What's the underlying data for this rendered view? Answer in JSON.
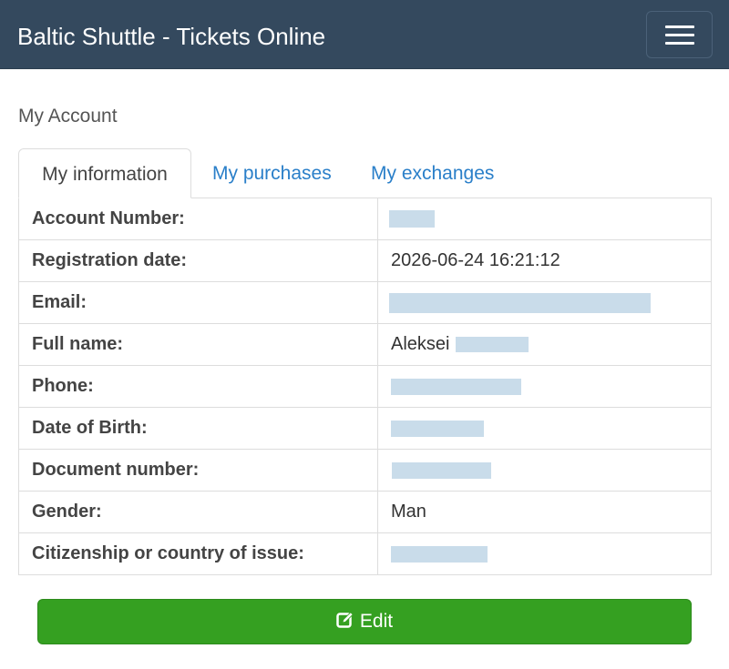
{
  "header": {
    "brand": "Baltic Shuttle - Tickets Online",
    "menu_icon": "hamburger-icon"
  },
  "page": {
    "title": "My Account"
  },
  "tabs": [
    {
      "label": "My information",
      "active": true
    },
    {
      "label": "My purchases",
      "active": false
    },
    {
      "label": "My exchanges",
      "active": false
    }
  ],
  "account": {
    "rows": [
      {
        "label": "Account Number:",
        "value": "",
        "redacted": true
      },
      {
        "label": "Registration date:",
        "value": "2026-06-24 16:21:12",
        "redacted": false
      },
      {
        "label": "Email:",
        "value": "",
        "redacted": true
      },
      {
        "label": "Full name:",
        "value": "Aleksei",
        "redacted": true
      },
      {
        "label": "Phone:",
        "value": "",
        "redacted": true
      },
      {
        "label": "Date of Birth:",
        "value": "",
        "redacted": true
      },
      {
        "label": "Document number:",
        "value": "",
        "redacted": true
      },
      {
        "label": "Gender:",
        "value": "Man",
        "redacted": false
      },
      {
        "label": "Citizenship or country of issue:",
        "value": "",
        "redacted": true
      }
    ]
  },
  "actions": {
    "edit_label": "Edit",
    "edit_icon": "edit-icon"
  },
  "colors": {
    "navbar": "#34495e",
    "link": "#2a7fc9",
    "button": "#35a021",
    "redaction": "#c9dcea"
  }
}
